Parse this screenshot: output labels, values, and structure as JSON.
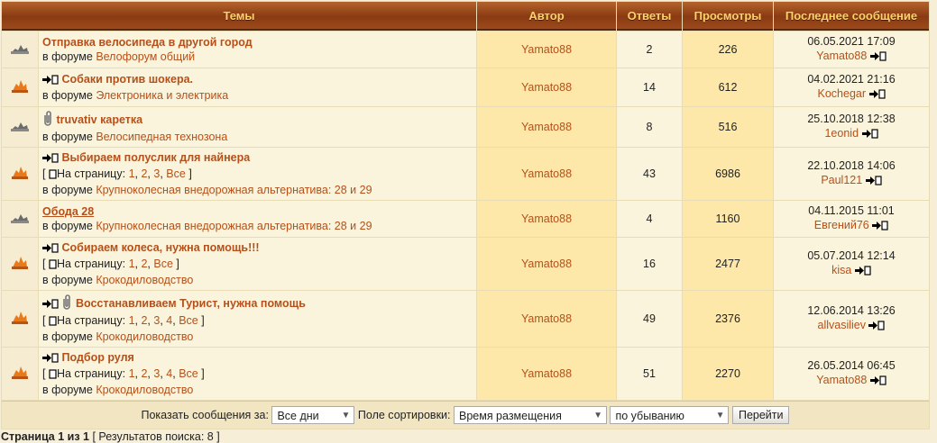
{
  "header": {
    "col_topics": "Темы",
    "col_author": "Автор",
    "col_replies": "Ответы",
    "col_views": "Просмотры",
    "col_last": "Последнее сообщение"
  },
  "forum_prefix": "в форуме",
  "page_prefix": "[",
  "page_label": "На страницу:",
  "page_suffix": "]",
  "rows": [
    {
      "title": "Отправка велосипеда в другой город",
      "forum": "Велофорум общий",
      "author": "Yamato88",
      "replies": "2",
      "views": "226",
      "last_date": "06.05.2021 17:09",
      "last_user": "Yamato88"
    },
    {
      "title": "Собаки против шокера.",
      "forum": "Электроника и электрика",
      "author": "Yamato88",
      "replies": "14",
      "views": "612",
      "last_date": "04.02.2021 21:16",
      "last_user": "Kochegar"
    },
    {
      "title": "truvativ каретка",
      "forum": "Велосипедная технозона",
      "author": "Yamato88",
      "replies": "8",
      "views": "516",
      "last_date": "25.10.2018 12:38",
      "last_user": "1eonid"
    },
    {
      "title": "Выбираем полуслик для найнера",
      "forum": "Крупноколесная внедорожная альтернатива: 28 и 29",
      "author": "Yamato88",
      "replies": "43",
      "views": "6986",
      "last_date": "22.10.2018 14:06",
      "last_user": "Paul121",
      "pages": [
        "1",
        "2",
        "3",
        "Все"
      ]
    },
    {
      "title": "Обода 28",
      "forum": "Крупноколесная внедорожная альтернатива: 28 и 29",
      "author": "Yamato88",
      "replies": "4",
      "views": "1160",
      "last_date": "04.11.2015 11:01",
      "last_user": "Евгений76"
    },
    {
      "title": "Собираем колеса, нужна помощь!!!",
      "forum": "Крокодиловодство",
      "author": "Yamato88",
      "replies": "16",
      "views": "2477",
      "last_date": "05.07.2014 12:14",
      "last_user": "kisa",
      "pages": [
        "1",
        "2",
        "Все"
      ]
    },
    {
      "title": "Восстанавливаем Турист, нужна помощь",
      "forum": "Крокодиловодство",
      "author": "Yamato88",
      "replies": "49",
      "views": "2376",
      "last_date": "12.06.2014 13:26",
      "last_user": "allvasiliev",
      "pages": [
        "1",
        "2",
        "3",
        "4",
        "Все"
      ]
    },
    {
      "title": "Подбор руля",
      "forum": "Крокодиловодство",
      "author": "Yamato88",
      "replies": "51",
      "views": "2270",
      "last_date": "26.05.2014 06:45",
      "last_user": "Yamato88",
      "pages": [
        "1",
        "2",
        "3",
        "4",
        "Все"
      ]
    }
  ],
  "footer": {
    "show_label": "Показать сообщения за:",
    "days_value": "Все дни",
    "sort_label": "Поле сортировки:",
    "sort_value": "Время размещения",
    "order_value": "по убыванию",
    "go_label": "Перейти"
  },
  "bottom": {
    "page_text": "Страница 1 из 1",
    "results_text": "[ Результатов поиска: 8 ]"
  }
}
